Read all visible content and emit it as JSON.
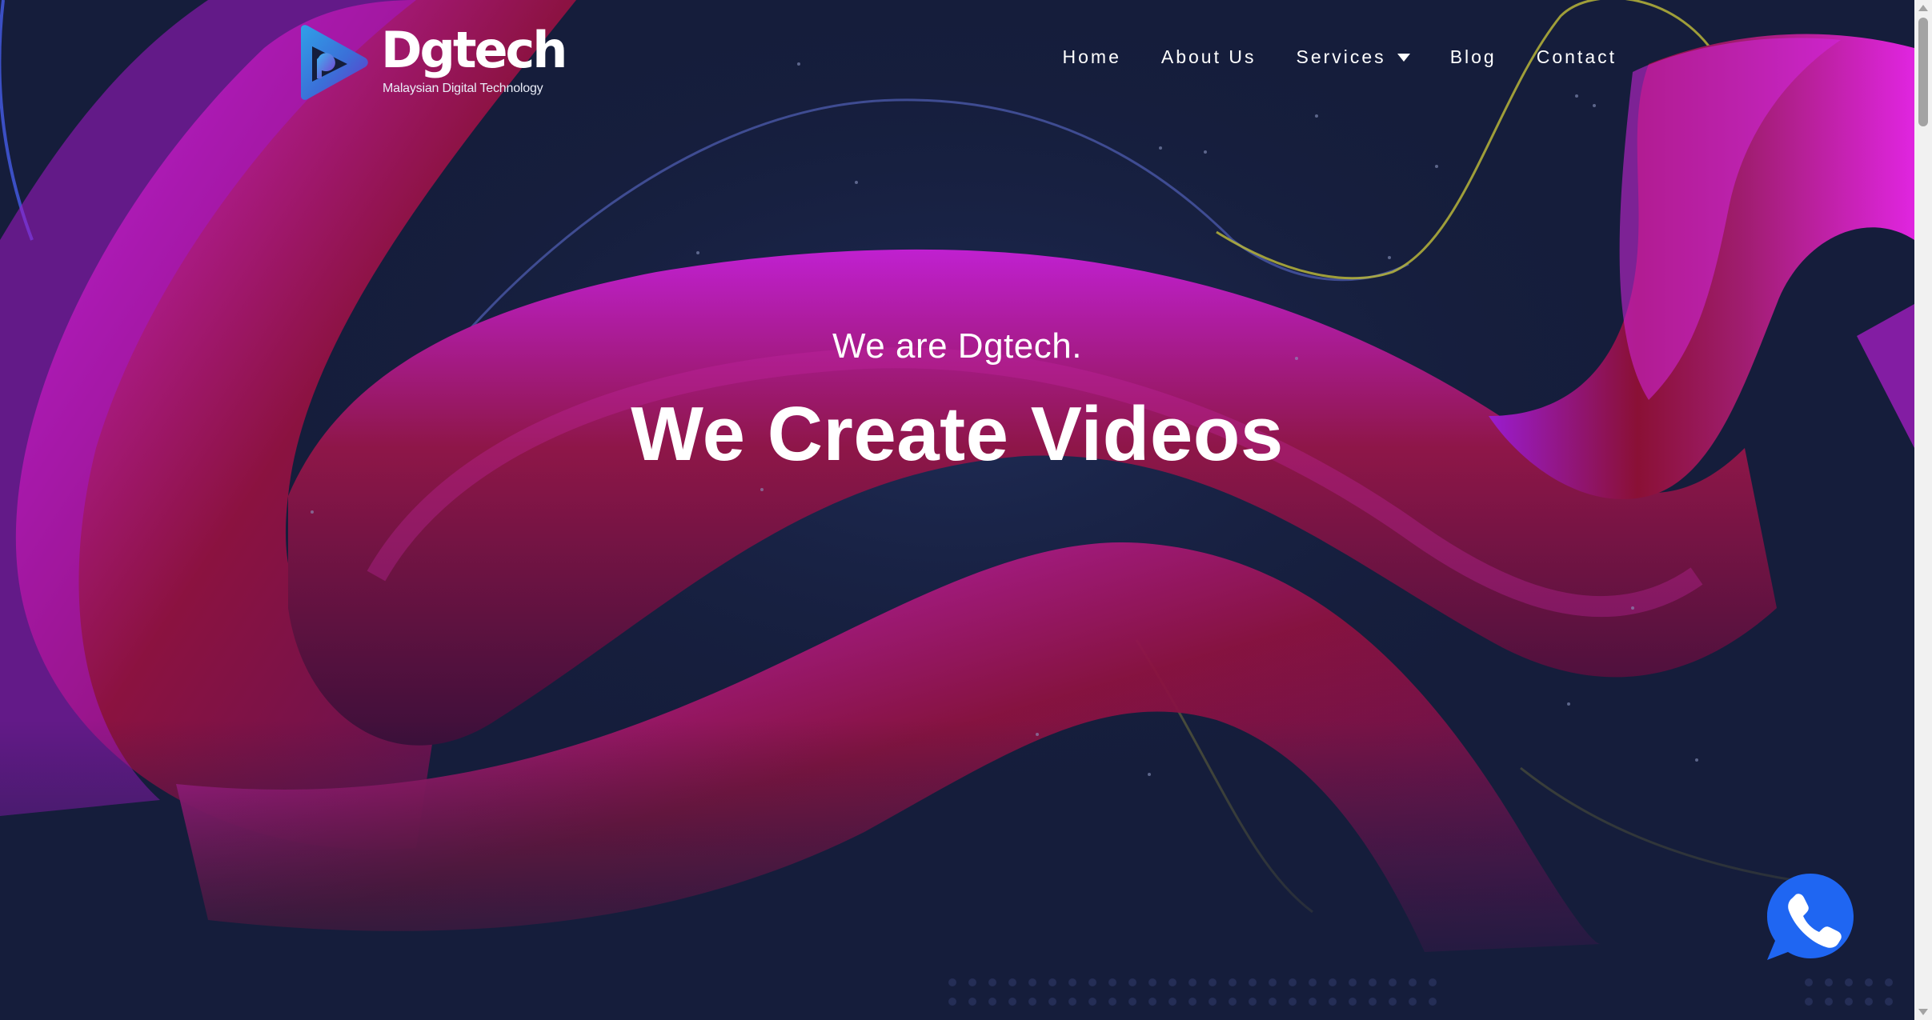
{
  "brand": {
    "name": "Dgtech",
    "tagline": "Malaysian Digital Technology",
    "logo_icon": "play-triangle-logo-icon"
  },
  "nav": {
    "items": [
      {
        "label": "Home"
      },
      {
        "label": "About Us"
      },
      {
        "label": "Services",
        "icon": "chevron-down-icon"
      },
      {
        "label": "Blog"
      },
      {
        "label": "Contact"
      }
    ]
  },
  "hero": {
    "subtitle": "We are Dgtech.",
    "title": "We Create Videos"
  },
  "floating": {
    "call_icon": "whatsapp-phone-icon"
  },
  "colors": {
    "background": "#151d3b",
    "ribbon_magenta": "#b51ed8",
    "ribbon_crimson": "#7a0f2c",
    "whatsapp_blue": "#1f66f2",
    "text": "#ffffff"
  }
}
